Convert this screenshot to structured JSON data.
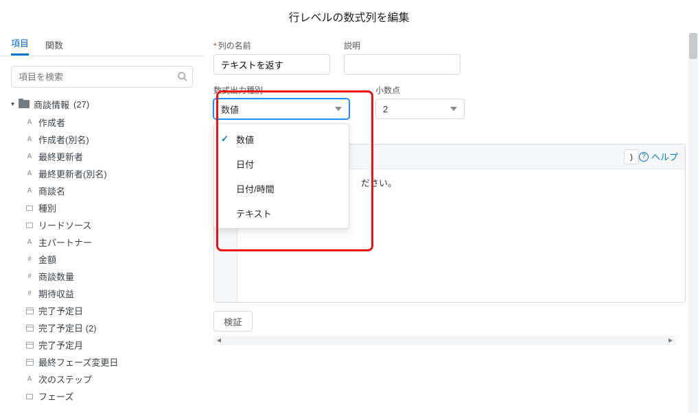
{
  "title": "行レベルの数式列を編集",
  "tabs": {
    "fields": "項目",
    "functions": "関数"
  },
  "search": {
    "placeholder": "項目を検索"
  },
  "tree": {
    "folder": {
      "label": "商談情報",
      "count": "(27)"
    },
    "items": [
      {
        "type": "A",
        "label": "作成者"
      },
      {
        "type": "A",
        "label": "作成者(別名)"
      },
      {
        "type": "A",
        "label": "最終更新者"
      },
      {
        "type": "A",
        "label": "最終更新者(別名)"
      },
      {
        "type": "A",
        "label": "商談名"
      },
      {
        "type": "rect",
        "label": "種別"
      },
      {
        "type": "rect",
        "label": "リードソース"
      },
      {
        "type": "A",
        "label": "主パートナー"
      },
      {
        "type": "#",
        "label": "金額"
      },
      {
        "type": "#",
        "label": "商談数量"
      },
      {
        "type": "#",
        "label": "期待収益"
      },
      {
        "type": "cal",
        "label": "完了予定日"
      },
      {
        "type": "cal",
        "label": "完了予定日 (2)"
      },
      {
        "type": "cal",
        "label": "完了予定月"
      },
      {
        "type": "cal",
        "label": "最終フェーズ変更日"
      },
      {
        "type": "A",
        "label": "次のステップ"
      },
      {
        "type": "rect",
        "label": "フェーズ"
      }
    ]
  },
  "form": {
    "column_name_label": "列の名前",
    "column_name_value": "テキストを返す",
    "description_label": "説明",
    "output_type_label": "数式出力種別",
    "output_type_value": "数値",
    "output_type_options": [
      "数値",
      "日付",
      "日付/時間",
      "テキスト"
    ],
    "decimals_label": "小数点",
    "decimals_value": "2",
    "paren_btn": ")",
    "help_label": "ヘルプ",
    "formula_placeholder_tail": "ださい。",
    "validate_label": "検証"
  }
}
